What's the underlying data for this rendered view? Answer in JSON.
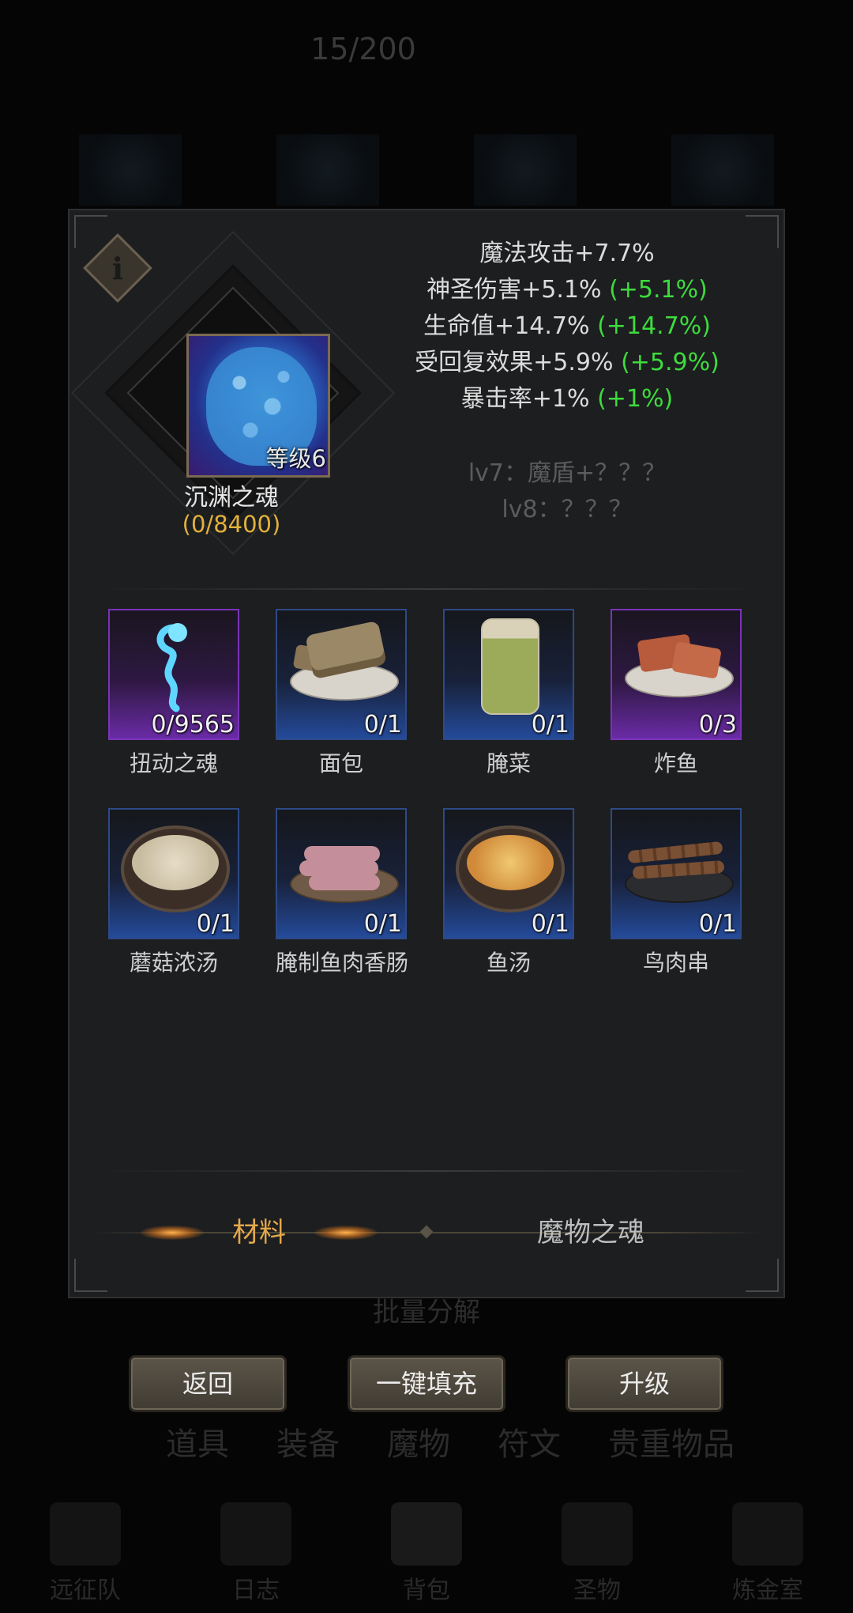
{
  "background": {
    "counter": "15/200",
    "split_button": "批量分解",
    "tabs": [
      "道具",
      "装备",
      "魔物",
      "符文",
      "贵重物品"
    ],
    "nav": [
      "远征队",
      "日志",
      "背包",
      "圣物",
      "炼金室"
    ]
  },
  "monster": {
    "level_label": "等级6",
    "name": "沉渊之魂",
    "progress": "(0/8400)"
  },
  "stats": [
    {
      "text": "魔法攻击+7.7%",
      "bonus": ""
    },
    {
      "text": "神圣伤害+5.1%",
      "bonus": "(+5.1%)"
    },
    {
      "text": "生命值+14.7%",
      "bonus": "(+14.7%)"
    },
    {
      "text": "受回复效果+5.9%",
      "bonus": "(+5.9%)"
    },
    {
      "text": "暴击率+1%",
      "bonus": "(+1%)"
    }
  ],
  "locked": [
    "lv7：魔盾+？？？",
    "lv8：？？？"
  ],
  "items": [
    {
      "name": "扭动之魂",
      "count": "0/9565",
      "rarity": "purple",
      "icon": "soul-wisp-icon"
    },
    {
      "name": "面包",
      "count": "0/1",
      "rarity": "blue",
      "icon": "bread-icon"
    },
    {
      "name": "腌菜",
      "count": "0/1",
      "rarity": "blue",
      "icon": "pickle-jar-icon"
    },
    {
      "name": "炸鱼",
      "count": "0/3",
      "rarity": "purple",
      "icon": "fried-fish-icon"
    },
    {
      "name": "蘑菇浓汤",
      "count": "0/1",
      "rarity": "blue",
      "icon": "mushroom-soup-icon"
    },
    {
      "name": "腌制鱼肉香肠",
      "count": "0/1",
      "rarity": "blue",
      "icon": "sausage-icon"
    },
    {
      "name": "鱼汤",
      "count": "0/1",
      "rarity": "blue",
      "icon": "fish-soup-icon"
    },
    {
      "name": "鸟肉串",
      "count": "0/1",
      "rarity": "blue",
      "icon": "skewer-icon"
    }
  ],
  "tabs": {
    "materials": "材料",
    "monster_souls": "魔物之魂"
  },
  "buttons": {
    "back": "返回",
    "auto_fill": "一键填充",
    "upgrade": "升级"
  },
  "colors": {
    "bonus": "#3ddc3d",
    "progress": "#e3b13a",
    "active_tab": "#e3a84a"
  }
}
